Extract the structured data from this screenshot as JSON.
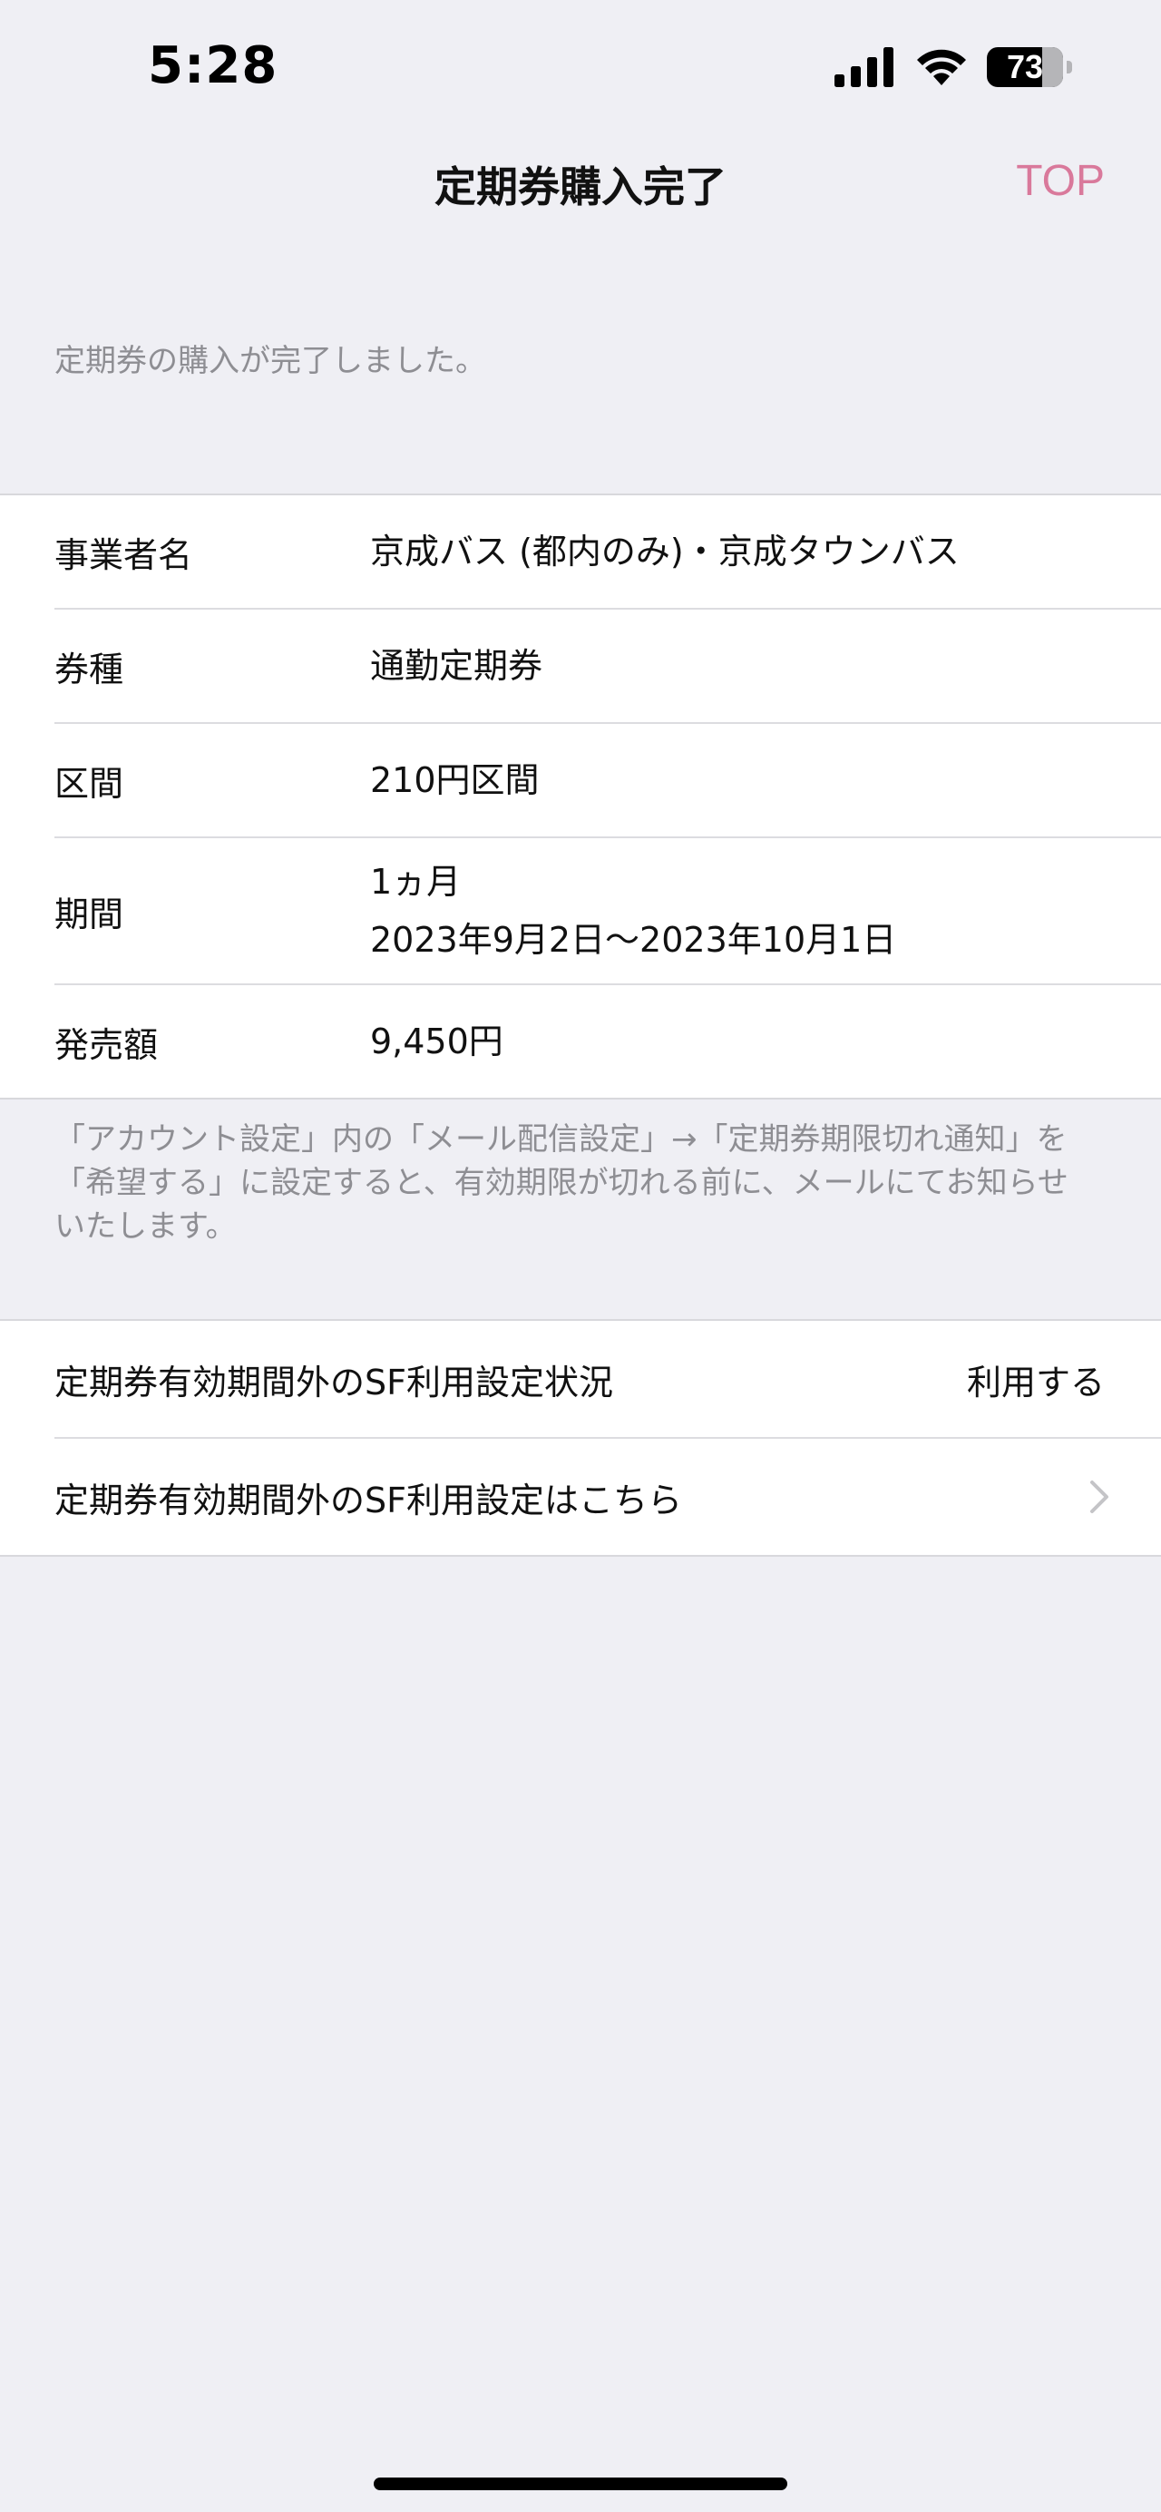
{
  "status_bar": {
    "time": "5:28",
    "battery_level": "73",
    "icons": [
      "signal-icon",
      "wifi-icon",
      "battery-icon"
    ]
  },
  "nav": {
    "title": "定期券購入完了",
    "top_label": "TOP",
    "top_color": "#d9799b"
  },
  "message": "定期券の購入が完了しました。",
  "details": [
    {
      "label": "事業者名",
      "value": "京成バス (都内のみ)・京成タウンバス"
    },
    {
      "label": "券種",
      "value": "通勤定期券"
    },
    {
      "label": "区間",
      "value": "210円区間"
    },
    {
      "label": "期間",
      "value_line1": "1ヵ月",
      "value_line2": "2023年9月2日〜2023年10月1日"
    },
    {
      "label": "発売額",
      "value": "9,450円"
    }
  ],
  "note": "「アカウント設定」内の「メール配信設定」→「定期券期限切れ通知」を「希望する」に設定すると、有効期限が切れる前に、メールにてお知らせいたします。",
  "sf": {
    "status_label": "定期券有効期間外のSF利用設定状況",
    "status_value": "利用する",
    "link_label": "定期券有効期間外のSF利用設定はこちら"
  }
}
